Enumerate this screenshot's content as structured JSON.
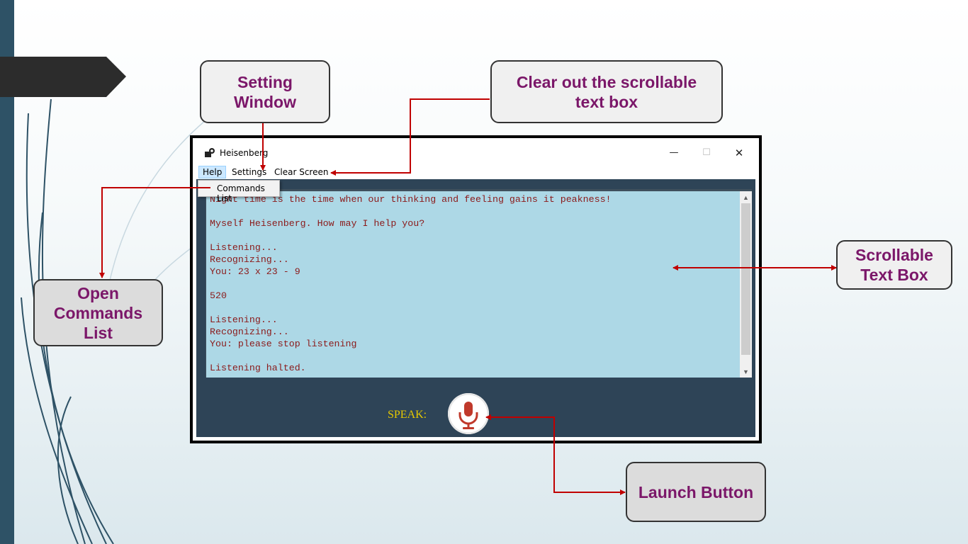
{
  "callouts": {
    "settings_window": "Setting\nWindow",
    "clear_screen": "Clear out the scrollable\ntext box",
    "open_commands": "Open\nCommands\nList",
    "scrollable": "Scrollable\nText Box",
    "launch": "Launch Button"
  },
  "window": {
    "title": "Heisenberg",
    "minimize": "—",
    "maximize": "☐",
    "close": "✕"
  },
  "menu": {
    "help": "Help",
    "settings": "Settings",
    "clear_screen": "Clear Screen",
    "dropdown_item": "Commands List"
  },
  "console": {
    "lines": [
      "Night time is the time when our thinking and feeling gains it peakness!",
      "",
      "Myself Heisenberg. How may I help you?",
      "",
      "Listening...",
      "Recognizing...",
      "You: 23 x 23 - 9",
      "",
      "520",
      "",
      "Listening...",
      "Recognizing...",
      "You: please stop listening",
      "",
      "Listening halted."
    ]
  },
  "bottom": {
    "speak_label": "SPEAK:"
  },
  "colors": {
    "callout_text": "#7b1769",
    "arrow": "#c00000",
    "window_bg": "#2e4457",
    "textbox_bg": "#add8e6",
    "console_text": "#8b1a1a",
    "speak_text": "#e6c800"
  },
  "icons": [
    "app-icon",
    "minimize-icon",
    "maximize-icon",
    "close-icon",
    "scroll-up-icon",
    "scroll-down-icon",
    "microphone-icon"
  ]
}
